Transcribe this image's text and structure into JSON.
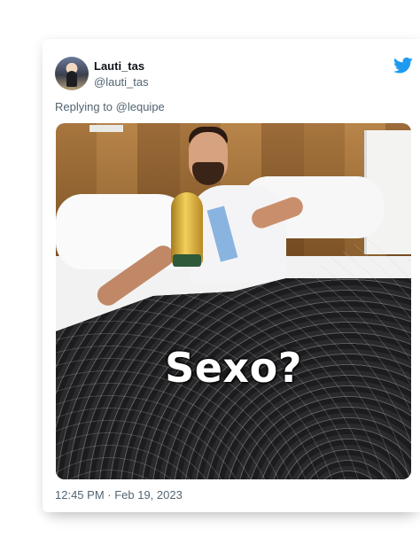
{
  "tweet": {
    "author_name": "Lauti_tas",
    "author_handle": "@lauti_tas",
    "replying_to": "Replying to @lequipe",
    "image_caption": "Sexo?",
    "timestamp": "12:45 PM · Feb 19, 2023"
  },
  "colors": {
    "brand_blue": "#1d9bf0",
    "text_primary": "#0f1419",
    "text_secondary": "#536471"
  },
  "icons": {
    "brand": "twitter-bird-icon"
  }
}
